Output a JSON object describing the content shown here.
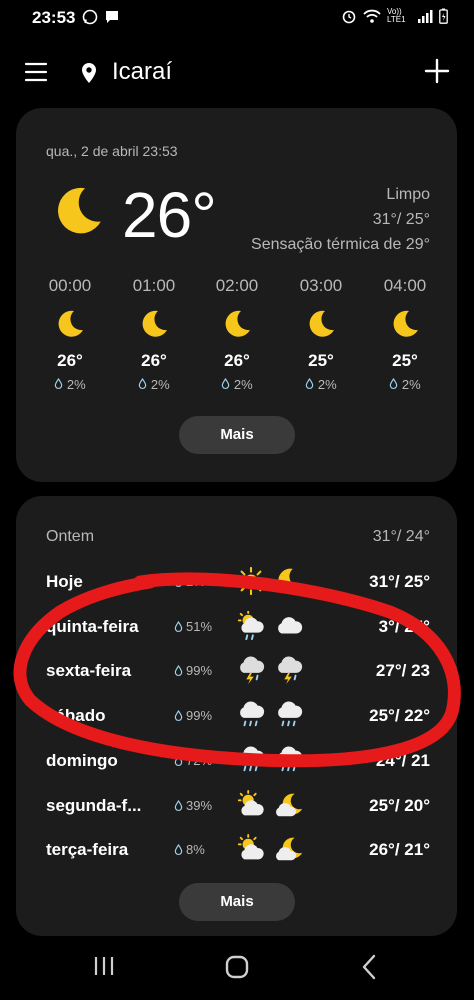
{
  "status_bar": {
    "time": "23:53",
    "network": "Vo)) LTE1"
  },
  "header": {
    "location": "Icaraí"
  },
  "current": {
    "date_time": "qua., 2 de abril 23:53",
    "temperature": "26°",
    "condition": "Limpo",
    "high_low": "31°/ 25°",
    "feels_like": "Sensação térmica de 29°",
    "icon": "moon-icon"
  },
  "hourly": [
    {
      "time": "00:00",
      "temp": "26°",
      "precip": "2%",
      "icon": "moon-icon"
    },
    {
      "time": "01:00",
      "temp": "26°",
      "precip": "2%",
      "icon": "moon-icon"
    },
    {
      "time": "02:00",
      "temp": "26°",
      "precip": "2%",
      "icon": "moon-icon"
    },
    {
      "time": "03:00",
      "temp": "25°",
      "precip": "2%",
      "icon": "moon-icon"
    },
    {
      "time": "04:00",
      "temp": "25°",
      "precip": "2%",
      "icon": "moon-icon"
    }
  ],
  "hourly_more_label": "Mais",
  "daily": {
    "yesterday_label": "Ontem",
    "yesterday_temps": "31°/ 24°",
    "days": [
      {
        "name": "Hoje",
        "precip": "2%",
        "icon_day": "sun-icon",
        "icon_night": "moon-icon",
        "temps": "31°/ 25°"
      },
      {
        "name": "quinta-feira",
        "precip": "51%",
        "icon_day": "sun-cloud-rain-icon",
        "icon_night": "cloud-icon",
        "temps": "3°/ 25°"
      },
      {
        "name": "sexta-feira",
        "precip": "99%",
        "icon_day": "thunderstorm-icon",
        "icon_night": "thunderstorm-icon",
        "temps": "27°/ 23"
      },
      {
        "name": "sábado",
        "precip": "99%",
        "icon_day": "rain-cloud-icon",
        "icon_night": "rain-cloud-icon",
        "temps": "25°/ 22°"
      },
      {
        "name": "domingo",
        "precip": "72%",
        "icon_day": "rain-cloud-icon",
        "icon_night": "rain-cloud-icon",
        "temps": "24°/ 21"
      },
      {
        "name": "segunda-f...",
        "precip": "39%",
        "icon_day": "sun-cloud-icon",
        "icon_night": "moon-cloud-icon",
        "temps": "25°/ 20°"
      },
      {
        "name": "terça-feira",
        "precip": "8%",
        "icon_day": "sun-cloud-icon",
        "icon_night": "moon-cloud-icon",
        "temps": "26°/ 21°"
      }
    ],
    "more_label": "Mais"
  },
  "colors": {
    "background": "#000000",
    "card": "#1c1c1c",
    "accent_yellow": "#f7c61c",
    "annotation_red": "#e61a1a",
    "button": "#3a3a3a"
  }
}
